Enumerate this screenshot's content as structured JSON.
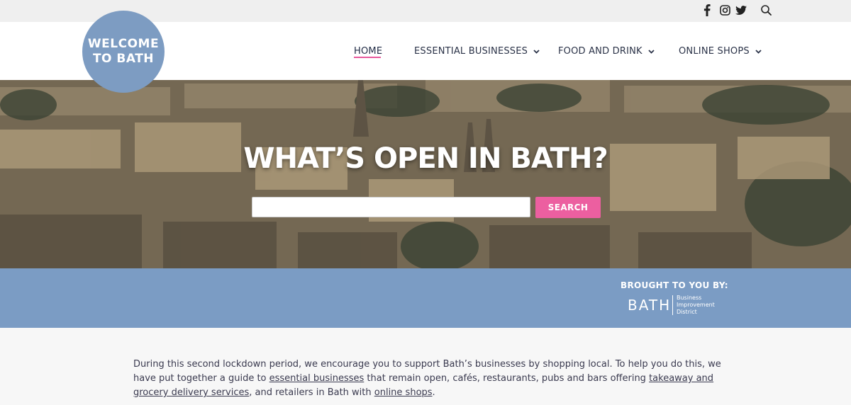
{
  "social": {
    "facebook_icon": "facebook-icon",
    "instagram_icon": "instagram-icon",
    "twitter_icon": "twitter-icon",
    "search_icon": "search-icon"
  },
  "logo": {
    "line1": "WELCOME",
    "line2": "TO BATH"
  },
  "nav": {
    "items": [
      {
        "label": "HOME",
        "active": true,
        "has_dropdown": false
      },
      {
        "label": "ESSENTIAL BUSINESSES",
        "has_dropdown": true
      },
      {
        "label": "FOOD AND DRINK",
        "has_dropdown": true
      },
      {
        "label": "ONLINE SHOPS",
        "has_dropdown": true
      }
    ]
  },
  "hero": {
    "title": "WHAT’S OPEN IN BATH?",
    "search_value": "",
    "search_button": "SEARCH"
  },
  "sponsor": {
    "heading": "BROUGHT TO YOU BY:",
    "logo_word": "BATH",
    "logo_line1": "Business",
    "logo_line2": "Improvement",
    "logo_line3": "District"
  },
  "intro": {
    "text1": "During this second lockdown period, we encourage you to support Bath’s businesses by shopping local. To help you do this, we have put together a guide to ",
    "link1": "essential businesses",
    "text2": " that remain open, cafés, restaurants, pubs and bars offering ",
    "link2": "takeaway and grocery delivery services",
    "text3": ", and retailers in Bath with ",
    "link3": "online shops",
    "text4": "."
  },
  "colors": {
    "accent_pink": "#ec5fa0",
    "brand_blue": "#7b9cc4",
    "logo_blue": "#7d9cc2"
  }
}
